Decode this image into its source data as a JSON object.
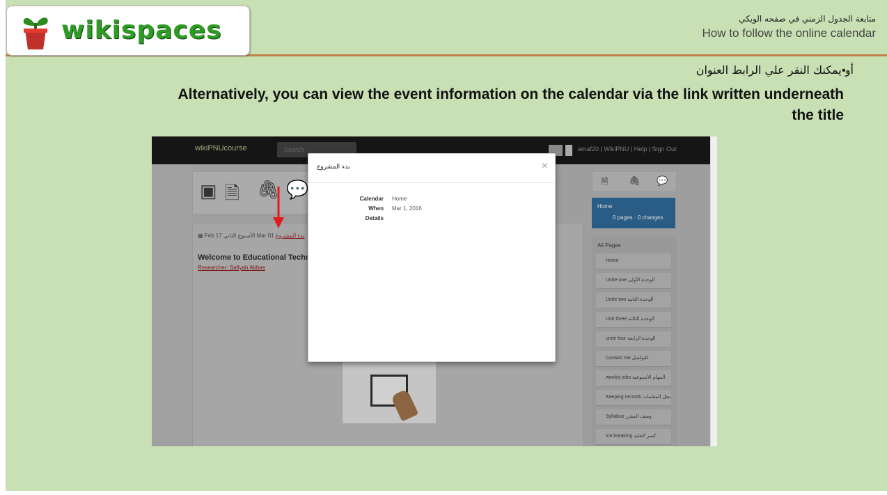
{
  "header": {
    "logo_text": "wikispaces",
    "title_ar": "متابعة الجدول الزمني في صفحه الويكي",
    "title_en": "How to follow the online calendar"
  },
  "content": {
    "bullet_ar": "أو يمكنك النقر علي الرابط العنوان",
    "text_en": "Alternatively, you can view the event information on the calendar via  the link written underneath the title"
  },
  "screenshot": {
    "brand": "wikiPNUcourse",
    "search_placeholder": "Search",
    "top_links": "amaf20 | WikiPNU | Help | Sign Out",
    "page_date_from": "Feb 17",
    "page_date_from_ar": "الأسبوع الثاني",
    "page_date_to": "Mar 01",
    "page_date_link": "بدء المشروع",
    "page_heading": "Welcome to Educational Techno",
    "page_subheading": "Researcher: Safiyah Abbas",
    "sidebar_home": "Home",
    "sidebar_counts": "0 pages · 0 changes",
    "sidebar_header": "All Pages",
    "sidebar_items": [
      "Home",
      "Unite one الوحدة الأولى",
      "Unite two الوحدة الثانية",
      "Unit three الوحدة الثالثة",
      "unite four الوحدة الرابعة",
      "Contact me للتواصل",
      "weekly jobs المهام الأسبوعية",
      "Keeping records سجل المعلمات",
      "Syllabus وصف المقرر",
      "Ice breaking كسر الجليد"
    ],
    "modal": {
      "title": "بدء المشروع",
      "close": "×",
      "calendar_label": "Calendar",
      "calendar_value": "Home",
      "when_label": "When",
      "when_value": "Mar 1, 2016",
      "details_label": "Details"
    }
  }
}
